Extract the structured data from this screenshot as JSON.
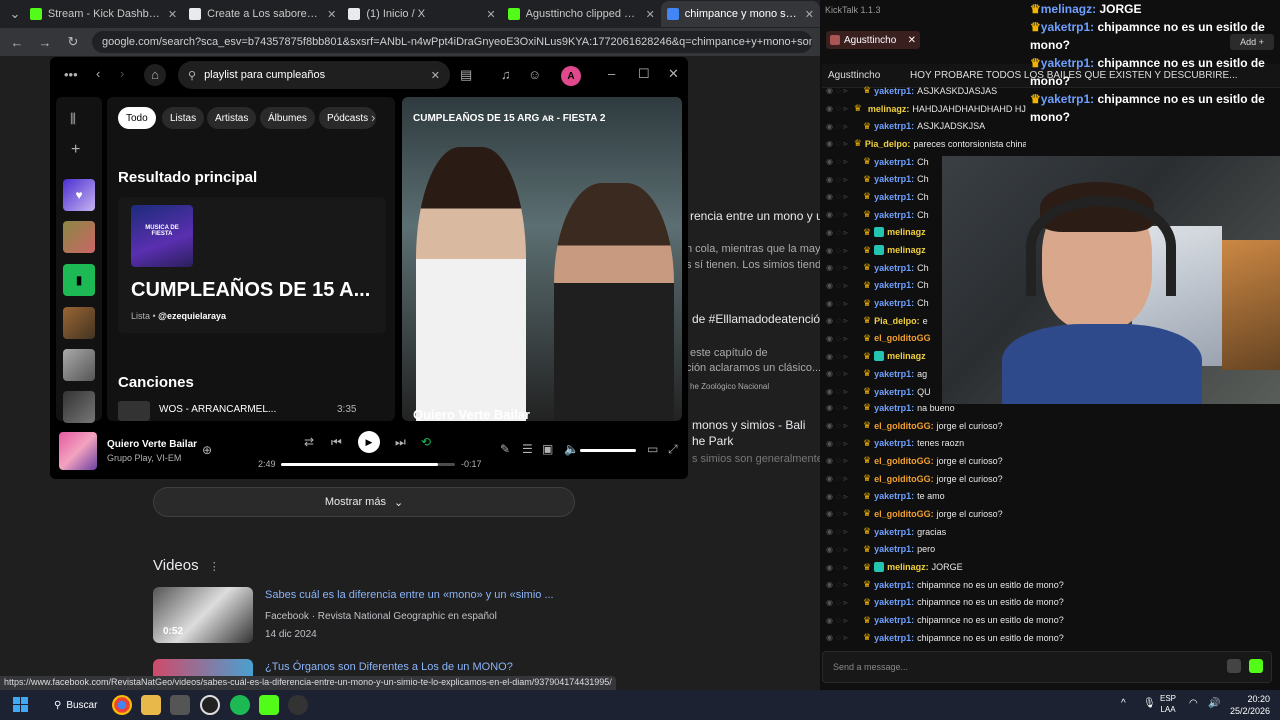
{
  "chrome": {
    "tabs": [
      {
        "title": "Stream - Kick Dashboard",
        "color": "#53fc18"
      },
      {
        "title": "Create a Los sabores de los jug",
        "color": "#e8eaed"
      },
      {
        "title": "(1) Inicio / X",
        "color": "#e8eaed"
      },
      {
        "title": "Agusttincho clipped by sAz000",
        "color": "#53fc18"
      },
      {
        "title": "chimpance y mono son dos co",
        "color": "#4285f4"
      }
    ],
    "url": "google.com/search?sca_esv=b74357875f8bb801&sxsrf=ANbL-n4wPpt4iDraGnyeoE3OxiNLus9KYA:1772061628246&q=chimpance+y+mono+son+dos+cosas+distintas&sour"
  },
  "google": {
    "snippets": [
      "rencia entre un mono y un s",
      "n cola, mientras que la mayorí",
      "s sí tienen. Los simios tienden a",
      "de #Elllamadodeatención",
      "este capítulo de",
      "ción aclaramos un clásico...",
      "he Zoológico Nacional",
      "monos y simios - Bali",
      "he Park",
      "s simios son generalmente"
    ],
    "more_label": "Mostrar más",
    "videos_heading": "Videos",
    "videos": [
      {
        "title": "Sabes cuál es la diferencia entre un «mono» y un «simio ...",
        "source": "Facebook · Revista National Geographic en español",
        "date": "14 dic 2024",
        "duration": "0:52"
      },
      {
        "title": "¿Tus Órganos son Diferentes a Los de un MONO?",
        "source": "",
        "date": "",
        "duration": ""
      }
    ],
    "status_url": "https://www.facebook.com/RevistaNatGeo/videos/sabes-cuál-es-la-diferencia-entre-un-mono-y-un-simio-te-lo-explicamos-en-el-diam/937904174431995/"
  },
  "spotify": {
    "search_value": "playlist para cumpleaños",
    "avatar_letter": "A",
    "filters": [
      "Todo",
      "Listas",
      "Artistas",
      "Álbumes",
      "Pódcasts"
    ],
    "top_result_heading": "Resultado principal",
    "top_result": {
      "name": "CUMPLEAÑOS DE 15 A...",
      "type": "Lista",
      "owner": "@ezequielaraya",
      "cover_text": "MUSICA DE FIESTA"
    },
    "songs_heading": "Canciones",
    "first_song": {
      "title": "WOS - ARRANCARMEL...",
      "duration": "3:35"
    },
    "now_playing_panel": {
      "title": "CUMPLEAÑOS DE 15 ARG ᴀʀ - FIESTA 2",
      "song": "Quiero Verte Bailar"
    },
    "player": {
      "song": "Quiero Verte Bailar",
      "artist": "Grupo Play, VI-EM",
      "elapsed": "2:49",
      "remaining": "-0:17",
      "progress": 0.9,
      "volume": 1.0
    }
  },
  "kicktalk": {
    "app_title": "KickTalk 1.1.3",
    "channel_tab": "Agusttincho",
    "channel": "Agusttincho",
    "banner": "HOY PROBARE TODOS LOS BAILES QUE EXISTEN Y DESCUBRIRE...",
    "add_label": "Add",
    "send_placeholder": "Send a message...",
    "overlay": [
      {
        "user": "melinagz:",
        "msg": "JORGE"
      },
      {
        "user": "yaketrp1:",
        "msg": "chipamnce no es un esitlo de mono?"
      },
      {
        "user": "yaketrp1:",
        "msg": "chipamnce no es un esitlo de mono?"
      },
      {
        "user": "yaketrp1:",
        "msg": "chipamnce no es un esitlo de mono?"
      }
    ],
    "top_messages": [
      {
        "user": "yaketrp1:",
        "msg": "ASJKASKDJASJAS",
        "color": "#6fa0ff",
        "badge": false
      },
      {
        "user": "melinagz:",
        "msg": "HAHDJAHDHAHDHAHD HJD",
        "color": "#f0d040",
        "badge": true
      },
      {
        "user": "yaketrp1:",
        "msg": "ASJKJADSKJSA",
        "color": "#6fa0ff",
        "badge": false
      },
      {
        "user": "Pia_delpo:",
        "msg": "pareces contorsionista china",
        "color": "#f0d040",
        "badge": false
      },
      {
        "user": "yaketrp1:",
        "msg": "Ch",
        "color": "#6fa0ff",
        "badge": false
      },
      {
        "user": "yaketrp1:",
        "msg": "Ch",
        "color": "#6fa0ff",
        "badge": false
      },
      {
        "user": "yaketrp1:",
        "msg": "Ch",
        "color": "#6fa0ff",
        "badge": false
      },
      {
        "user": "yaketrp1:",
        "msg": "Ch",
        "color": "#6fa0ff",
        "badge": false
      },
      {
        "user": "melinagz",
        "msg": "",
        "color": "#f0d040",
        "badge": true
      },
      {
        "user": "melinagz",
        "msg": "",
        "color": "#f0d040",
        "badge": true
      },
      {
        "user": "yaketrp1:",
        "msg": "Ch",
        "color": "#6fa0ff",
        "badge": false
      },
      {
        "user": "yaketrp1:",
        "msg": "Ch",
        "color": "#6fa0ff",
        "badge": false
      },
      {
        "user": "yaketrp1:",
        "msg": "Ch",
        "color": "#6fa0ff",
        "badge": false
      },
      {
        "user": "Pia_delpo:",
        "msg": "e",
        "color": "#f0d040",
        "badge": false
      },
      {
        "user": "el_golditoGG",
        "msg": "",
        "color": "#f0a030",
        "badge": false
      },
      {
        "user": "melinagz",
        "msg": "",
        "color": "#f0d040",
        "badge": true
      },
      {
        "user": "yaketrp1:",
        "msg": "ag",
        "color": "#6fa0ff",
        "badge": false
      },
      {
        "user": "yaketrp1:",
        "msg": "QU",
        "color": "#6fa0ff",
        "badge": false
      }
    ],
    "bottom_messages": [
      {
        "user": "yaketrp1:",
        "msg": "na bueno",
        "color": "#6fa0ff",
        "badge": false
      },
      {
        "user": "el_golditoGG:",
        "msg": "jorge el curioso?",
        "color": "#f0a030",
        "badge": false
      },
      {
        "user": "yaketrp1:",
        "msg": "tenes raozn",
        "color": "#6fa0ff",
        "badge": false
      },
      {
        "user": "el_golditoGG:",
        "msg": "jorge el curioso?",
        "color": "#f0a030",
        "badge": false
      },
      {
        "user": "el_golditoGG:",
        "msg": "jorge el curioso?",
        "color": "#f0a030",
        "badge": false
      },
      {
        "user": "yaketrp1:",
        "msg": "te amo",
        "color": "#6fa0ff",
        "badge": false
      },
      {
        "user": "el_golditoGG:",
        "msg": "jorge el curioso?",
        "color": "#f0a030",
        "badge": false
      },
      {
        "user": "yaketrp1:",
        "msg": "gracias",
        "color": "#6fa0ff",
        "badge": false
      },
      {
        "user": "yaketrp1:",
        "msg": "pero",
        "color": "#6fa0ff",
        "badge": false
      },
      {
        "user": "melinagz:",
        "msg": "JORGE",
        "color": "#f0d040",
        "badge": true
      },
      {
        "user": "yaketrp1:",
        "msg": "chipamnce no es un esitlo de mono?",
        "color": "#6fa0ff",
        "badge": false
      },
      {
        "user": "yaketrp1:",
        "msg": "chipamnce no es un esitlo de mono?",
        "color": "#6fa0ff",
        "badge": false
      },
      {
        "user": "yaketrp1:",
        "msg": "chipamnce no es un esitlo de mono?",
        "color": "#6fa0ff",
        "badge": false
      },
      {
        "user": "yaketrp1:",
        "msg": "chipamnce no es un esitlo de mono?",
        "color": "#6fa0ff",
        "badge": false
      }
    ]
  },
  "taskbar": {
    "search_label": "Buscar",
    "lang_top": "ESP",
    "lang_bottom": "LAA",
    "time": "20:20",
    "date": "25/2/2026"
  }
}
